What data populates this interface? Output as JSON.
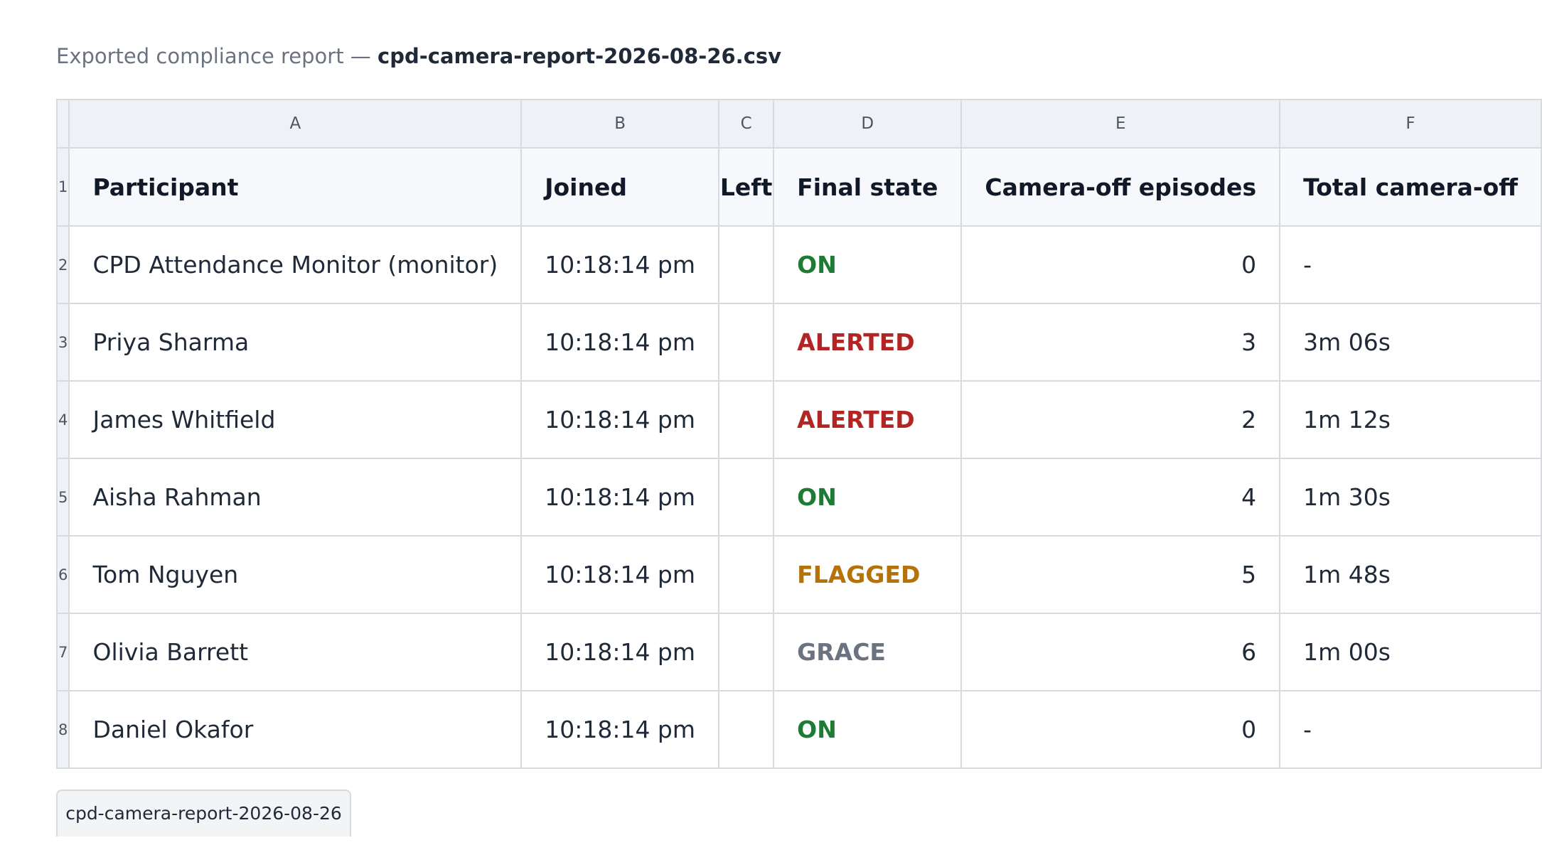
{
  "caption": {
    "prefix": "Exported compliance report —",
    "filename": "cpd-camera-report-2026-08-26.csv"
  },
  "columns": [
    "A",
    "B",
    "C",
    "D",
    "E",
    "F"
  ],
  "header": {
    "row_number": "1",
    "participant": "Participant",
    "joined": "Joined",
    "left": "Left",
    "final_state": "Final state",
    "episodes": "Camera-off episodes",
    "total_off": "Total camera-off"
  },
  "rows": [
    {
      "row_number": "2",
      "participant": "CPD Attendance Monitor (monitor)",
      "joined": "10:18:14 pm",
      "left": "",
      "final_state": "ON",
      "state_color": "#1e7b34",
      "episodes": "0",
      "total_off": "-"
    },
    {
      "row_number": "3",
      "participant": "Priya Sharma",
      "joined": "10:18:14 pm",
      "left": "",
      "final_state": "ALERTED",
      "state_color": "#b32424",
      "episodes": "3",
      "total_off": "3m 06s"
    },
    {
      "row_number": "4",
      "participant": "James Whitfield",
      "joined": "10:18:14 pm",
      "left": "",
      "final_state": "ALERTED",
      "state_color": "#b32424",
      "episodes": "2",
      "total_off": "1m 12s"
    },
    {
      "row_number": "5",
      "participant": "Aisha Rahman",
      "joined": "10:18:14 pm",
      "left": "",
      "final_state": "ON",
      "state_color": "#1e7b34",
      "episodes": "4",
      "total_off": "1m 30s"
    },
    {
      "row_number": "6",
      "participant": "Tom Nguyen",
      "joined": "10:18:14 pm",
      "left": "",
      "final_state": "FLAGGED",
      "state_color": "#b47208",
      "episodes": "5",
      "total_off": "1m 48s"
    },
    {
      "row_number": "7",
      "participant": "Olivia Barrett",
      "joined": "10:18:14 pm",
      "left": "",
      "final_state": "GRACE",
      "state_color": "#6b7280",
      "episodes": "6",
      "total_off": "1m 00s"
    },
    {
      "row_number": "8",
      "participant": "Daniel Okafor",
      "joined": "10:18:14 pm",
      "left": "",
      "final_state": "ON",
      "state_color": "#1e7b34",
      "episodes": "0",
      "total_off": "-"
    }
  ],
  "sheet_tab": {
    "label": "cpd-camera-report-2026-08-26"
  }
}
